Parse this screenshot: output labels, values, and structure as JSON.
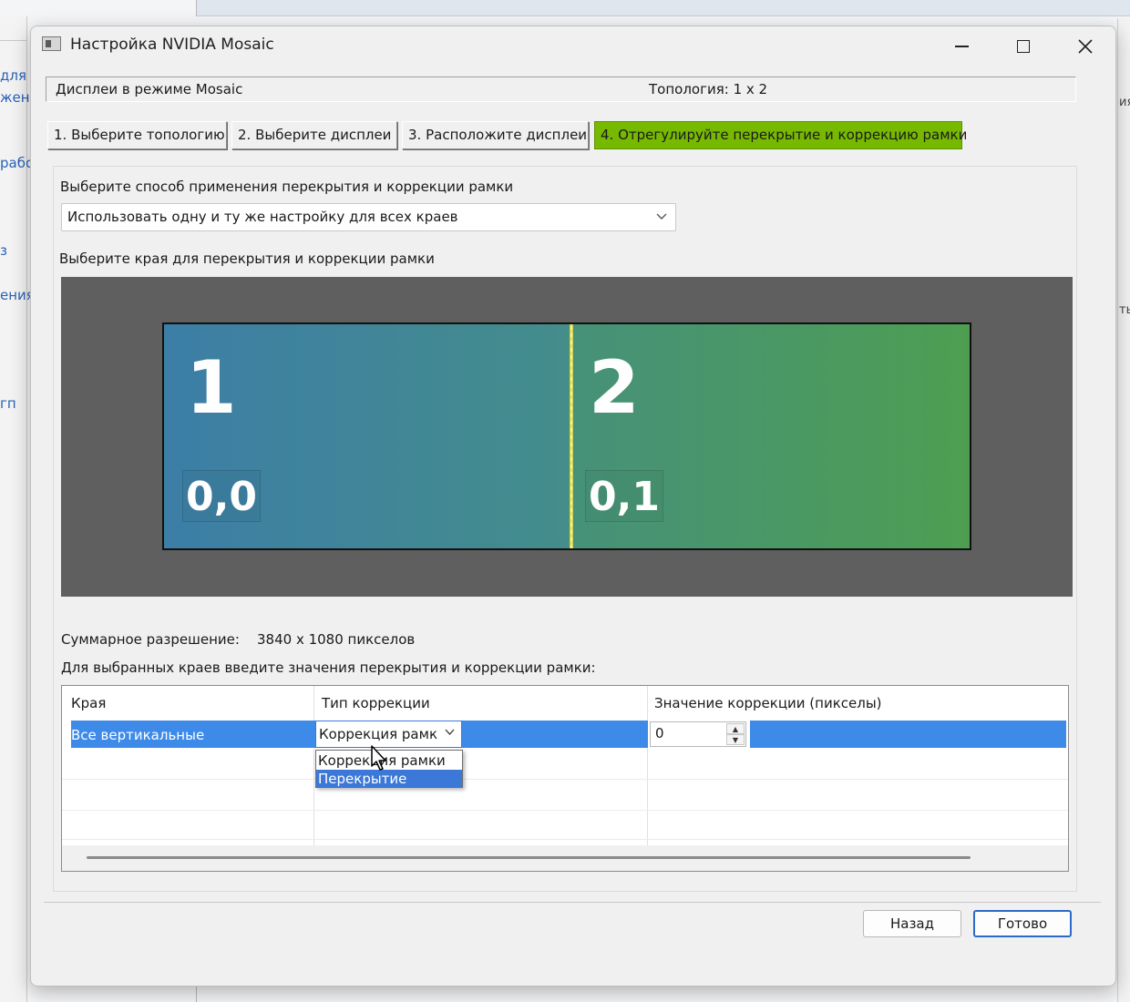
{
  "background": {
    "left_fragments": [
      "для",
      "жен",
      "рабо",
      "з",
      "ения",
      "гп"
    ],
    "right_fragments": [
      "ия",
      "ть"
    ]
  },
  "window": {
    "title": "Настройка NVIDIA Mosaic",
    "controls": {
      "minimize": "minimize-icon",
      "maximize": "maximize-icon",
      "close": "close-icon"
    }
  },
  "status": {
    "mode": "Дисплеи в режиме Mosaic",
    "topology": "Топология: 1 x 2"
  },
  "steps": [
    {
      "label": "1. Выберите топологию"
    },
    {
      "label": "2. Выберите дисплеи"
    },
    {
      "label": "3. Расположите дисплеи"
    },
    {
      "label": "4. Отрегулируйте перекрытие и коррекцию рамки",
      "active": true
    }
  ],
  "method": {
    "label": "Выберите способ применения перекрытия и коррекции рамки",
    "selected": "Использовать одну и ту же настройку для всех краев"
  },
  "edges_label": "Выберите края для перекрытия и коррекции рамки",
  "displays": [
    {
      "number": "1",
      "coord": "0,0"
    },
    {
      "number": "2",
      "coord": "0,1"
    }
  ],
  "total": {
    "label": "Суммарное разрешение:",
    "value": "3840 x 1080 пикселов"
  },
  "grid": {
    "intro": "Для выбранных краев введите значения перекрытия и коррекции рамки:",
    "headers": [
      "Края",
      "Тип коррекции",
      "Значение коррекции (пикселы)"
    ],
    "row": {
      "edges": "Все вертикальные",
      "type": "Коррекция рамки",
      "value": "0"
    },
    "type_options": [
      "Коррекция рамки",
      "Перекрытие"
    ],
    "highlighted_option": "Перекрытие"
  },
  "buttons": {
    "back": "Назад",
    "done": "Готово"
  },
  "colors": {
    "active_step": "#76b900",
    "selection": "#3d8ae8",
    "seam": "#e6e65a"
  }
}
